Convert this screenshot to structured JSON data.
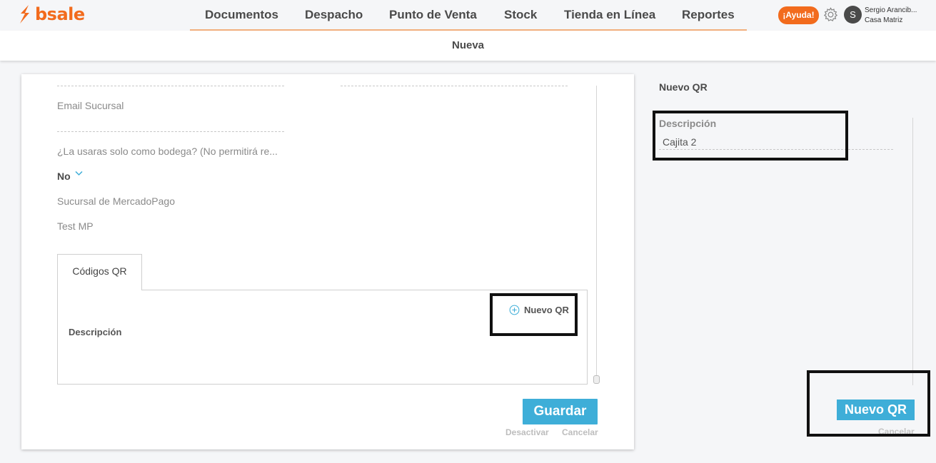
{
  "brand": {
    "logo_text": "bsale",
    "accent": "#f26b1d"
  },
  "nav": {
    "items": [
      "Documentos",
      "Despacho",
      "Punto de Venta",
      "Stock",
      "Tienda en Línea",
      "Reportes"
    ],
    "help_label": "¡Ayuda!",
    "settings_icon": "gear-icon",
    "user_initial": "S",
    "user_name": "Sergio Arancib...",
    "user_branch": "Casa Matriz"
  },
  "subbar": {
    "title": "Nueva"
  },
  "form": {
    "email_label": "Email Sucursal",
    "bodega_label": "¿La usaras solo como bodega? (No permitirá re...",
    "bodega_value": "No",
    "mp_label": "Sucursal de MercadoPago",
    "mp_value": "Test MP",
    "tab_label": "Códigos QR",
    "table_header": "Descripción",
    "new_qr_link": "Nuevo QR",
    "save_label": "Guardar",
    "deactivate_label": "Desactivar",
    "cancel_label": "Cancelar"
  },
  "side": {
    "title": "Nuevo QR",
    "desc_label": "Descripción",
    "desc_value": "Cajita 2",
    "create_label": "Nuevo QR",
    "cancel_label": "Cancelar"
  },
  "colors": {
    "primary_button": "#3eaed8",
    "highlight_border": "#111111"
  }
}
